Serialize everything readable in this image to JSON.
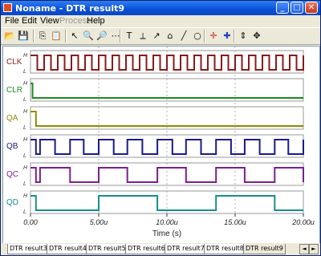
{
  "window": {
    "title": "Noname - DTR result9",
    "buttons": {
      "minimize": "_",
      "maximize": "□",
      "close": "✕"
    }
  },
  "menu": [
    {
      "label": "File",
      "enabled": true
    },
    {
      "label": "Edit",
      "enabled": true
    },
    {
      "label": "View",
      "enabled": true
    },
    {
      "label": "Process",
      "enabled": false
    },
    {
      "label": "Help",
      "enabled": true
    }
  ],
  "toolbar": {
    "tools": [
      {
        "name": "open-icon",
        "glyph": "📂"
      },
      {
        "name": "save-icon",
        "glyph": "💾"
      },
      {
        "name": "copy-icon",
        "glyph": "⎘"
      },
      {
        "name": "paste-icon",
        "glyph": "📋"
      },
      {
        "name": "select-arrow-icon",
        "glyph": "↖"
      },
      {
        "name": "zoom-in-icon",
        "glyph": "🔍"
      },
      {
        "name": "zoom-out-icon",
        "glyph": "🔎"
      },
      {
        "name": "grid-icon",
        "glyph": "⋯"
      },
      {
        "name": "text-icon",
        "glyph": "T"
      },
      {
        "name": "measure-icon",
        "glyph": "⟂"
      },
      {
        "name": "cursor-icon",
        "glyph": "↗"
      },
      {
        "name": "marker-icon",
        "glyph": "⌂"
      },
      {
        "name": "line-icon",
        "glyph": "╱"
      },
      {
        "name": "circle-icon",
        "glyph": "○"
      },
      {
        "name": "crosshair-red-icon",
        "glyph": "✛"
      },
      {
        "name": "crosshair-blue-icon",
        "glyph": "✚"
      },
      {
        "name": "scale-icon",
        "glyph": "⇕"
      },
      {
        "name": "move-icon",
        "glyph": "✥"
      }
    ]
  },
  "plot": {
    "traces": [
      {
        "label": "CLK",
        "color": "#8b1a1a"
      },
      {
        "label": "CLR",
        "color": "#1f8a1f"
      },
      {
        "label": "QA",
        "color": "#8c8c00"
      },
      {
        "label": "QB",
        "color": "#1a1a8c"
      },
      {
        "label": "QC",
        "color": "#7a1f8c"
      },
      {
        "label": "QD",
        "color": "#1a8c8c"
      }
    ],
    "level_high": "H",
    "level_low": "L",
    "x_ticks": [
      "0.00",
      "5.00u",
      "10.00u",
      "15.00u",
      "20.00u"
    ],
    "x_label": "Time (s)"
  },
  "chart_data": {
    "type": "line",
    "xlabel": "Time (s)",
    "xlim": [
      0,
      20
    ],
    "x_unit": "u",
    "series": [
      {
        "name": "CLK",
        "transitions_us": [
          0,
          0.5,
          1,
          1.5,
          2,
          2.5,
          3,
          3.5,
          4,
          4.5,
          5,
          5.5,
          6,
          6.5,
          7,
          7.5,
          8,
          8.5,
          9,
          9.5,
          10,
          10.5,
          11,
          11.5,
          12,
          12.5,
          13,
          13.5,
          14,
          14.5,
          15,
          15.5,
          16,
          16.5,
          17,
          17.5,
          18,
          18.5,
          19,
          19.5,
          20
        ],
        "start_level": "H"
      },
      {
        "name": "CLR",
        "transitions_us": [
          0,
          0.15
        ],
        "start_level": "H"
      },
      {
        "name": "QA",
        "transitions_us": [
          0,
          0.4
        ],
        "start_level": "H"
      },
      {
        "name": "QB",
        "transitions_us": [
          0,
          0.4,
          0.7,
          1.8,
          2.9,
          3.9,
          5.0,
          6.1,
          7.1,
          8.2,
          9.3,
          10.4,
          11.4,
          12.5,
          13.6,
          14.7,
          15.7,
          16.8,
          17.9,
          18.9,
          20
        ],
        "start_level": "H"
      },
      {
        "name": "QC",
        "transitions_us": [
          0,
          0.4,
          0.7,
          2.9,
          5.0,
          7.1,
          9.3,
          11.4,
          13.6,
          15.7,
          17.9,
          20
        ],
        "start_level": "H"
      },
      {
        "name": "QD",
        "transitions_us": [
          0,
          0.4,
          5.0,
          9.3,
          13.6,
          17.9
        ],
        "start_level": "H"
      }
    ]
  },
  "tabs": {
    "items": [
      "DTR result3",
      "DTR result4",
      "DTR result5",
      "DTR result6",
      "DTR result7",
      "DTR result8",
      "DTR result9"
    ],
    "active_index": 6
  }
}
